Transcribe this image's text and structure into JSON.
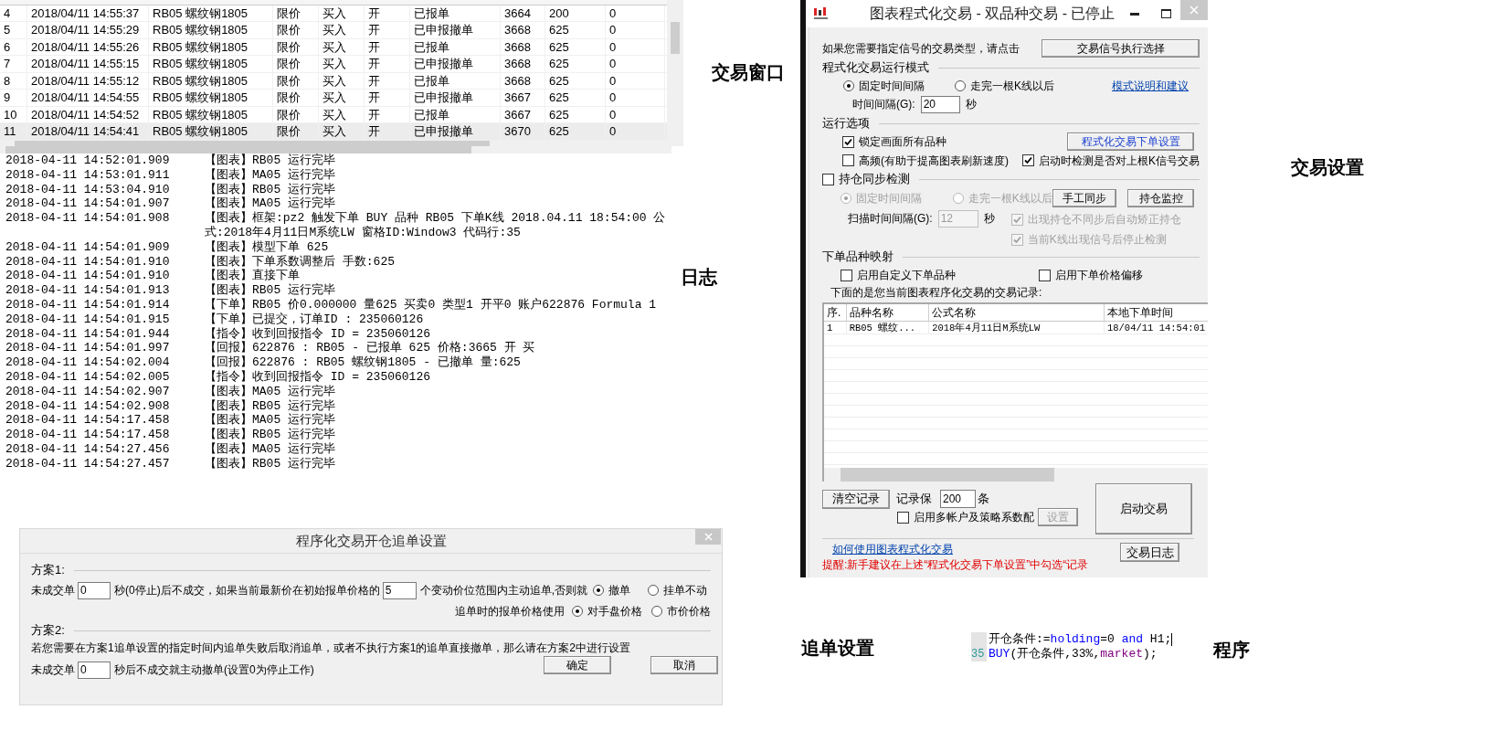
{
  "trade_window": {
    "label": "交易窗口",
    "rows": [
      {
        "no": "4",
        "time": "2018/04/11 14:55:37",
        "symbol": "RB05 螺纹钢1805",
        "price_type": "限价",
        "direction": "买入",
        "offset": "开",
        "status": "已报单",
        "price": "3664",
        "quantity": "200",
        "filled": "0",
        "selected": false
      },
      {
        "no": "5",
        "time": "2018/04/11 14:55:29",
        "symbol": "RB05 螺纹钢1805",
        "price_type": "限价",
        "direction": "买入",
        "offset": "开",
        "status": "已申报撤单",
        "price": "3668",
        "quantity": "625",
        "filled": "0",
        "selected": false
      },
      {
        "no": "6",
        "time": "2018/04/11 14:55:26",
        "symbol": "RB05 螺纹钢1805",
        "price_type": "限价",
        "direction": "买入",
        "offset": "开",
        "status": "已报单",
        "price": "3668",
        "quantity": "625",
        "filled": "0",
        "selected": false
      },
      {
        "no": "7",
        "time": "2018/04/11 14:55:15",
        "symbol": "RB05 螺纹钢1805",
        "price_type": "限价",
        "direction": "买入",
        "offset": "开",
        "status": "已申报撤单",
        "price": "3668",
        "quantity": "625",
        "filled": "0",
        "selected": false
      },
      {
        "no": "8",
        "time": "2018/04/11 14:55:12",
        "symbol": "RB05 螺纹钢1805",
        "price_type": "限价",
        "direction": "买入",
        "offset": "开",
        "status": "已报单",
        "price": "3668",
        "quantity": "625",
        "filled": "0",
        "selected": false
      },
      {
        "no": "9",
        "time": "2018/04/11 14:54:55",
        "symbol": "RB05 螺纹钢1805",
        "price_type": "限价",
        "direction": "买入",
        "offset": "开",
        "status": "已申报撤单",
        "price": "3667",
        "quantity": "625",
        "filled": "0",
        "selected": false
      },
      {
        "no": "10",
        "time": "2018/04/11 14:54:52",
        "symbol": "RB05 螺纹钢1805",
        "price_type": "限价",
        "direction": "买入",
        "offset": "开",
        "status": "已报单",
        "price": "3667",
        "quantity": "625",
        "filled": "0",
        "selected": false
      },
      {
        "no": "11",
        "time": "2018/04/11 14:54:41",
        "symbol": "RB05 螺纹钢1805",
        "price_type": "限价",
        "direction": "买入",
        "offset": "开",
        "status": "已申报撤单",
        "price": "3670",
        "quantity": "625",
        "filled": "0",
        "selected": true
      }
    ]
  },
  "log": {
    "label": "日志",
    "lines": [
      {
        "time": "2018-04-11 14:52:01.909",
        "message": "【图表】RB05 运行完毕"
      },
      {
        "time": "2018-04-11 14:53:01.911",
        "message": "【图表】MA05 运行完毕"
      },
      {
        "time": "2018-04-11 14:53:04.910",
        "message": "【图表】RB05 运行完毕"
      },
      {
        "time": "2018-04-11 14:54:01.907",
        "message": "【图表】MA05 运行完毕"
      },
      {
        "time": "2018-04-11 14:54:01.908",
        "message": "【图表】框架:pz2 触发下单 BUY 品种 RB05 下单K线 2018.04.11 18:54:00 公式:2018年4月11日M系统LW 窗格ID:Window3 代码行:35"
      },
      {
        "time": "2018-04-11 14:54:01.909",
        "message": "【图表】模型下单 625"
      },
      {
        "time": "2018-04-11 14:54:01.910",
        "message": "【图表】下单系数调整后 手数:625"
      },
      {
        "time": "2018-04-11 14:54:01.910",
        "message": "【图表】直接下单"
      },
      {
        "time": "2018-04-11 14:54:01.913",
        "message": "【图表】RB05 运行完毕"
      },
      {
        "time": "2018-04-11 14:54:01.914",
        "message": "【下单】RB05 价0.000000 量625 买卖0 类型1 开平0 账户622876 Formula 1"
      },
      {
        "time": "2018-04-11 14:54:01.915",
        "message": "【下单】已提交，订单ID : 235060126"
      },
      {
        "time": "2018-04-11 14:54:01.944",
        "message": "【指令】收到回报指令 ID = 235060126"
      },
      {
        "time": "2018-04-11 14:54:01.997",
        "message": "【回报】622876 : RB05 - 已报单 625 价格:3665 开 买"
      },
      {
        "time": "2018-04-11 14:54:02.004",
        "message": "【回报】622876 : RB05 螺纹钢1805 - 已撤单 量:625"
      },
      {
        "time": "2018-04-11 14:54:02.005",
        "message": "【指令】收到回报指令 ID = 235060126"
      },
      {
        "time": "2018-04-11 14:54:02.907",
        "message": "【图表】MA05 运行完毕"
      },
      {
        "time": "2018-04-11 14:54:02.908",
        "message": "【图表】RB05 运行完毕"
      },
      {
        "time": "2018-04-11 14:54:17.458",
        "message": "【图表】MA05 运行完毕"
      },
      {
        "time": "2018-04-11 14:54:17.458",
        "message": "【图表】RB05 运行完毕"
      },
      {
        "time": "2018-04-11 14:54:27.456",
        "message": "【图表】MA05 运行完毕"
      },
      {
        "time": "2018-04-11 14:54:27.457",
        "message": "【图表】RB05 运行完毕"
      }
    ]
  },
  "trade_settings": {
    "label": "交易设置",
    "title": "图表程式化交易 - 双品种交易 - 已停止",
    "signal_prompt": "如果您需要指定信号的交易类型，请点击",
    "signal_button": "交易信号执行选择",
    "run_mode": {
      "title": "程式化交易运行模式",
      "options": [
        {
          "label": "固定时间间隔",
          "selected": true
        },
        {
          "label": "走完一根K线以后",
          "selected": false
        }
      ],
      "link": "模式说明和建议",
      "interval_label": "时间间隔(G):",
      "interval_value": "20",
      "interval_unit": "秒"
    },
    "run_options": {
      "title": "运行选项",
      "order_settings_button": "程式化交易下单设置",
      "checkboxes": [
        {
          "label": "锁定画面所有品种",
          "checked": true
        },
        {
          "label": "高频(有助于提高图表刷新速度)",
          "checked": false
        },
        {
          "label": "启动时检测是否对上根K信号交易",
          "checked": true
        }
      ]
    },
    "position_sync": {
      "label": "持仓同步检测",
      "checked": false,
      "options": [
        {
          "label": "固定时间间隔",
          "selected": true,
          "disabled": true
        },
        {
          "label": "走完一根K线以后",
          "selected": false,
          "disabled": true
        }
      ],
      "manual_sync_button": "手工同步",
      "monitor_button": "持仓监控",
      "scan_label": "扫描时间间隔(G):",
      "scan_value": "12",
      "scan_unit": "秒",
      "checkboxes": [
        {
          "label": "出现持仓不同步后自动矫正持仓",
          "checked": true,
          "disabled": true
        },
        {
          "label": "当前K线出现信号后停止检测",
          "checked": true,
          "disabled": true
        }
      ]
    },
    "mapping": {
      "title": "下单品种映射",
      "checkboxes": [
        {
          "label": "启用自定义下单品种",
          "checked": false
        },
        {
          "label": "启用下单价格偏移",
          "checked": false
        }
      ]
    },
    "records_caption": "下面的是您当前图表程序化交易的交易记录:",
    "records": {
      "columns": [
        "序.",
        "品种名称",
        "公式名称",
        "本地下单时间"
      ],
      "rows": [
        [
          "1",
          "RB05 螺纹...",
          "2018年4月11日M系统LW",
          "18/04/11 14:54:01"
        ]
      ]
    },
    "clear_button": "清空记录",
    "keep_label": "记录保",
    "keep_value": "200",
    "keep_unit": "条",
    "multi_account": {
      "label": "启用多帐户及策略系数配",
      "checked": false
    },
    "setup_button": {
      "label": "设置",
      "disabled": true
    },
    "start_button": "启动交易",
    "help_link": "如何使用图表程式化交易",
    "reminder": "提醒:新手建议在上述“程式化交易下单设置”中勾选“记录",
    "log_button": "交易日志"
  },
  "chase_settings": {
    "label": "追单设置",
    "title": "程序化交易开仓追单设置",
    "scheme1": {
      "title": "方案1:",
      "prefix": "未成交单",
      "seconds_value": "0",
      "middle": "秒(0停止)后不成交，如果当前最新价在初始报单价格的",
      "ticks_value": "5",
      "suffix": "个变动价位范围内主动追单,否则就",
      "fallback_options": [
        {
          "label": "撤单",
          "selected": true
        },
        {
          "label": "挂单不动",
          "selected": false
        }
      ],
      "price_label": "追单时的报单价格使用",
      "price_options": [
        {
          "label": "对手盘价格",
          "selected": true
        },
        {
          "label": "市价价格",
          "selected": false
        }
      ]
    },
    "scheme2": {
      "title": "方案2:",
      "description": "若您需要在方案1追单设置的指定时间内追单失败后取消追单，或者不执行方案1的追单直接撤单，那么请在方案2中进行设置",
      "prefix": "未成交单",
      "seconds_value": "0",
      "suffix": "秒后不成交就主动撤单(设置0为停止工作)"
    },
    "buttons": [
      "确定",
      "取消"
    ]
  },
  "program": {
    "label": "程序",
    "line_number": "35",
    "lines": [
      [
        {
          "text": "开仓条件:=",
          "kind": "plain"
        },
        {
          "text": "holding",
          "kind": "keyword"
        },
        {
          "text": "=0 ",
          "kind": "plain"
        },
        {
          "text": "and",
          "kind": "keyword"
        },
        {
          "text": " H1;",
          "kind": "plain"
        }
      ],
      [
        {
          "text": "BUY",
          "kind": "function"
        },
        {
          "text": "(开仓条件,33%,",
          "kind": "plain"
        },
        {
          "text": "market",
          "kind": "constant"
        },
        {
          "text": ");",
          "kind": "plain"
        }
      ]
    ]
  }
}
